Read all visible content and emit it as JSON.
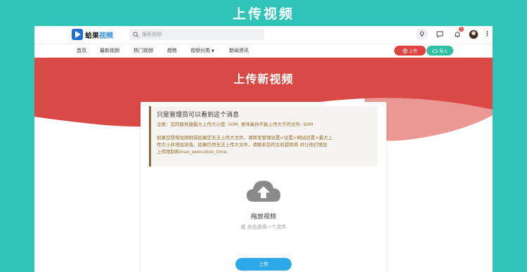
{
  "banner": {
    "title": "上传视频"
  },
  "header": {
    "logo_text_a": "蛤果",
    "logo_text_b": "视频",
    "search_placeholder": "搜索视频",
    "notification_count": "1",
    "icons": [
      "bulb-icon",
      "chat-icon",
      "bell-icon",
      "avatar",
      "more-icon"
    ]
  },
  "nav": {
    "items": [
      "首页",
      "最新视频",
      "热门视频",
      "趋势",
      "视频分类",
      "新闻资讯"
    ],
    "upload_label": "上传",
    "import_label": "导入"
  },
  "hero": {
    "title": "上传新视频"
  },
  "notice": {
    "title": "只是管理员可以看到这个消息",
    "line1": "注意：您的服务器最大上传大小是: 50M, 意味着你不能上传大于的文件: 50M",
    "body1": "如果您想增加限制或如果您无法上传大文件，请转至管理设置>设置>网站设置>最大上",
    "body2": "传大小并增加该值，如果仍然无法上传大文件，请联系您的主机提供商 并让他们增加",
    "body3": "上传限制和max_execution_time."
  },
  "dropzone": {
    "title": "拖放视频",
    "subtitle": "或 点击选择一个文件",
    "button": "上传"
  },
  "colors": {
    "page_bg": "#2ec4b8",
    "hero_red": "#d94a46",
    "upload_red": "#e0443f",
    "import_teal": "#2ebfa5",
    "primary_blue": "#2ea9e8"
  }
}
